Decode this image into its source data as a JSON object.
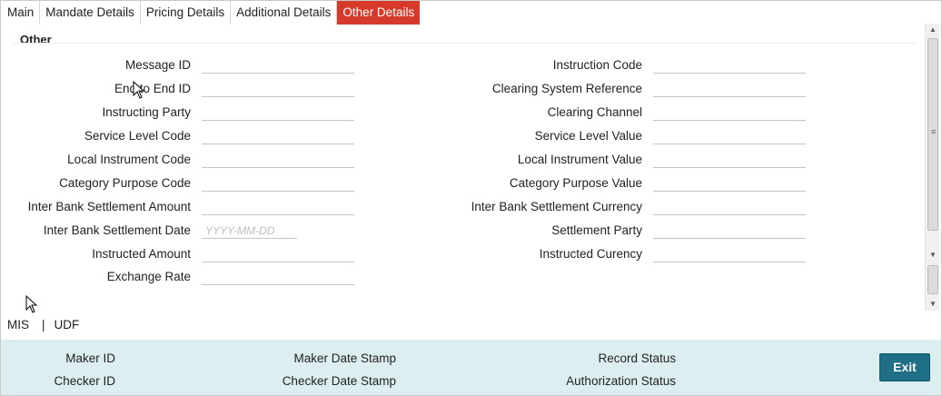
{
  "tabs": [
    {
      "label": "Main"
    },
    {
      "label": "Mandate Details"
    },
    {
      "label": "Pricing Details"
    },
    {
      "label": "Additional Details"
    },
    {
      "label": "Other Details"
    }
  ],
  "section": {
    "title": "Other"
  },
  "left_fields": [
    {
      "label": "Message ID",
      "value": ""
    },
    {
      "label": "End to End ID",
      "value": ""
    },
    {
      "label": "Instructing Party",
      "value": ""
    },
    {
      "label": "Service Level Code",
      "value": ""
    },
    {
      "label": "Local Instrument Code",
      "value": ""
    },
    {
      "label": "Category Purpose Code",
      "value": ""
    },
    {
      "label": "Inter Bank Settlement Amount",
      "value": ""
    },
    {
      "label": "Inter Bank Settlement Date",
      "value": "",
      "placeholder": "YYYY-MM-DD"
    },
    {
      "label": "Instructed Amount",
      "value": ""
    },
    {
      "label": "Exchange Rate",
      "value": ""
    }
  ],
  "right_fields": [
    {
      "label": "Instruction Code",
      "value": ""
    },
    {
      "label": "Clearing System Reference",
      "value": ""
    },
    {
      "label": "Clearing Channel",
      "value": ""
    },
    {
      "label": "Service Level Value",
      "value": ""
    },
    {
      "label": "Local Instrument Value",
      "value": ""
    },
    {
      "label": "Category Purpose Value",
      "value": ""
    },
    {
      "label": "Inter Bank Settlement Currency",
      "value": ""
    },
    {
      "label": "Settlement Party",
      "value": ""
    },
    {
      "label": "Instructed Curency",
      "value": ""
    }
  ],
  "links": {
    "mis": "MIS",
    "separator": "|",
    "udf": "UDF"
  },
  "footer": {
    "maker_id": "Maker ID",
    "checker_id": "Checker ID",
    "maker_date_stamp": "Maker Date Stamp",
    "checker_date_stamp": "Checker Date Stamp",
    "record_status": "Record Status",
    "authorization_status": "Authorization Status",
    "exit_label": "Exit"
  },
  "colors": {
    "active_tab": "#d63a2b",
    "footer_bg": "#ddeef0",
    "exit_button": "#1f6f86"
  },
  "icons": {
    "cursor": "mouse-pointer-icon"
  }
}
